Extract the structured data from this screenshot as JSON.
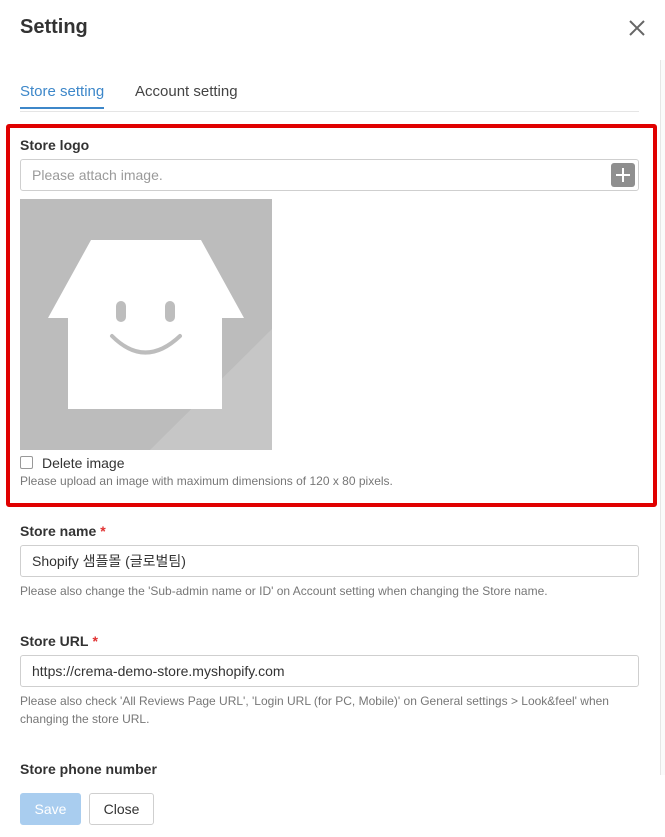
{
  "dialog": {
    "title": "Setting"
  },
  "tabs": [
    {
      "label": "Store setting",
      "active": true
    },
    {
      "label": "Account setting",
      "active": false
    }
  ],
  "store_logo": {
    "label": "Store logo",
    "placeholder": "Please attach image.",
    "delete_label": "Delete image",
    "delete_checked": false,
    "hint": "Please upload an image with maximum dimensions of 120 x 80 pixels."
  },
  "store_name": {
    "label": "Store name",
    "required_mark": "*",
    "value": "Shopify 샘플몰 (글로벌팀)",
    "hint": "Please also change the 'Sub-admin name or ID' on Account setting when changing the Store name."
  },
  "store_url": {
    "label": "Store URL",
    "required_mark": "*",
    "value": "https://crema-demo-store.myshopify.com",
    "hint": "Please also check 'All Reviews Page URL', 'Login URL (for PC, Mobile)' on General settings > Look&feel' when changing the store URL."
  },
  "store_phone": {
    "label": "Store phone number"
  },
  "buttons": {
    "save": "Save",
    "close": "Close"
  },
  "icons": {
    "close": "close-icon",
    "attach": "plus-icon",
    "preview": "store-placeholder-icon"
  },
  "colors": {
    "accent": "#3d87c9",
    "highlight_border": "#e00000",
    "required": "#e03030",
    "save_disabled": "#a9cdef"
  }
}
